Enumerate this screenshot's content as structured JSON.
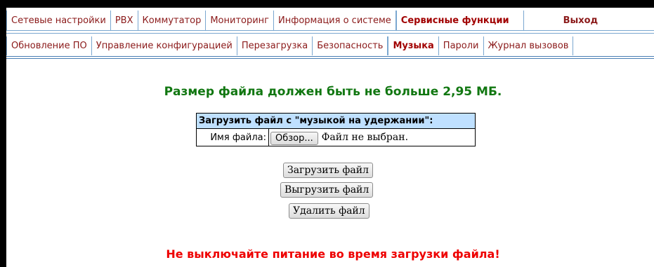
{
  "top_menu": {
    "items": [
      {
        "label": "Сетевые настройки"
      },
      {
        "label": "PBX"
      },
      {
        "label": "Коммутатор"
      },
      {
        "label": "Мониторинг"
      },
      {
        "label": "Информация о системе"
      },
      {
        "label": "Сервисные функции",
        "active": true
      },
      {
        "label": "Выход"
      }
    ]
  },
  "sub_menu": {
    "items": [
      {
        "label": "Обновление ПО"
      },
      {
        "label": "Управление конфигурацией"
      },
      {
        "label": "Перезагрузка"
      },
      {
        "label": "Безопасность"
      },
      {
        "label": "Музыка",
        "active": true
      },
      {
        "label": "Пароли"
      },
      {
        "label": "Журнал вызовов"
      }
    ]
  },
  "main": {
    "size_warning": "Размер файла должен быть не больше 2,95 МБ.",
    "upload_form": {
      "title": "Загрузить файл с \"музыкой на удержании\":",
      "filename_label": "Имя файла:",
      "browse_label": "Обзор...",
      "no_file_text": "Файл не выбран."
    },
    "buttons": {
      "upload": "Загрузить файл",
      "download": "Выгрузить файл",
      "delete": "Удалить файл"
    },
    "power_warning": "Не выключайте питание во время загрузки файла!"
  },
  "colors": {
    "menu_text": "#8b1a1a",
    "menu_border": "#7aa7d0",
    "table_header_bg": "#bfe0ff",
    "size_warning": "#117711",
    "power_warning": "#ee0000"
  }
}
